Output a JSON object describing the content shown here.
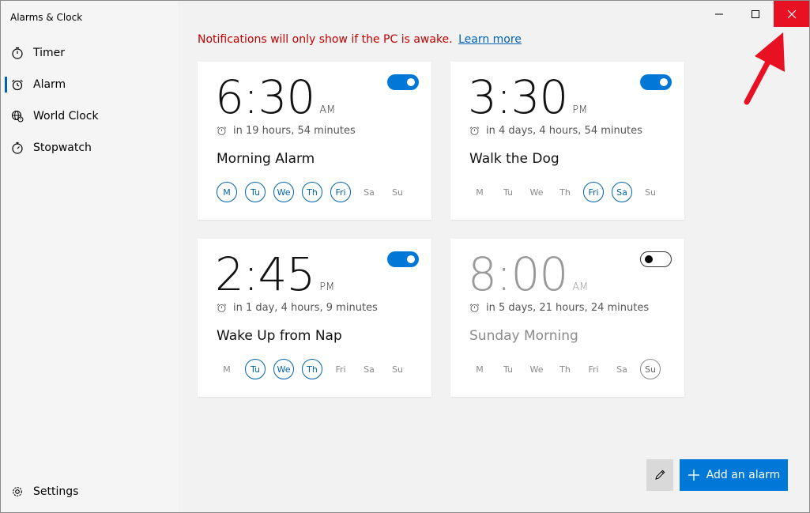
{
  "window": {
    "title": "Alarms & Clock"
  },
  "sidebar": {
    "items": [
      {
        "label": "Timer",
        "icon": "timer-icon",
        "active": false
      },
      {
        "label": "Alarm",
        "icon": "alarm-icon",
        "active": true
      },
      {
        "label": "World Clock",
        "icon": "globe-icon",
        "active": false
      },
      {
        "label": "Stopwatch",
        "icon": "stopwatch-icon",
        "active": false
      }
    ],
    "settings_label": "Settings"
  },
  "notice": {
    "text": "Notifications will only show if the PC is awake.",
    "link": "Learn more",
    "color": "#c00000"
  },
  "day_labels": [
    "M",
    "Tu",
    "We",
    "Th",
    "Fri",
    "Sa",
    "Su"
  ],
  "alarms": [
    {
      "time": "6:30",
      "ampm": "AM",
      "until": "in 19 hours, 54 minutes",
      "name": "Morning Alarm",
      "enabled": true,
      "days": [
        true,
        true,
        true,
        true,
        true,
        false,
        false
      ]
    },
    {
      "time": "3:30",
      "ampm": "PM",
      "until": "in 4 days, 4 hours, 54 minutes",
      "name": "Walk the Dog",
      "enabled": true,
      "days": [
        false,
        false,
        false,
        false,
        true,
        true,
        false
      ]
    },
    {
      "time": "2:45",
      "ampm": "PM",
      "until": "in 1 day, 4 hours, 9 minutes",
      "name": "Wake Up from Nap",
      "enabled": true,
      "days": [
        false,
        true,
        true,
        true,
        false,
        false,
        false
      ]
    },
    {
      "time": "8:00",
      "ampm": "AM",
      "until": "in 5 days, 21 hours, 24 minutes",
      "name": "Sunday Morning",
      "enabled": false,
      "days": [
        false,
        false,
        false,
        false,
        false,
        false,
        true
      ]
    }
  ],
  "actions": {
    "add_label": "Add an alarm",
    "edit_icon": "pencil-icon"
  },
  "colors": {
    "accent": "#0078d7",
    "close": "#e81123",
    "annotation_arrow": "#e81123"
  }
}
